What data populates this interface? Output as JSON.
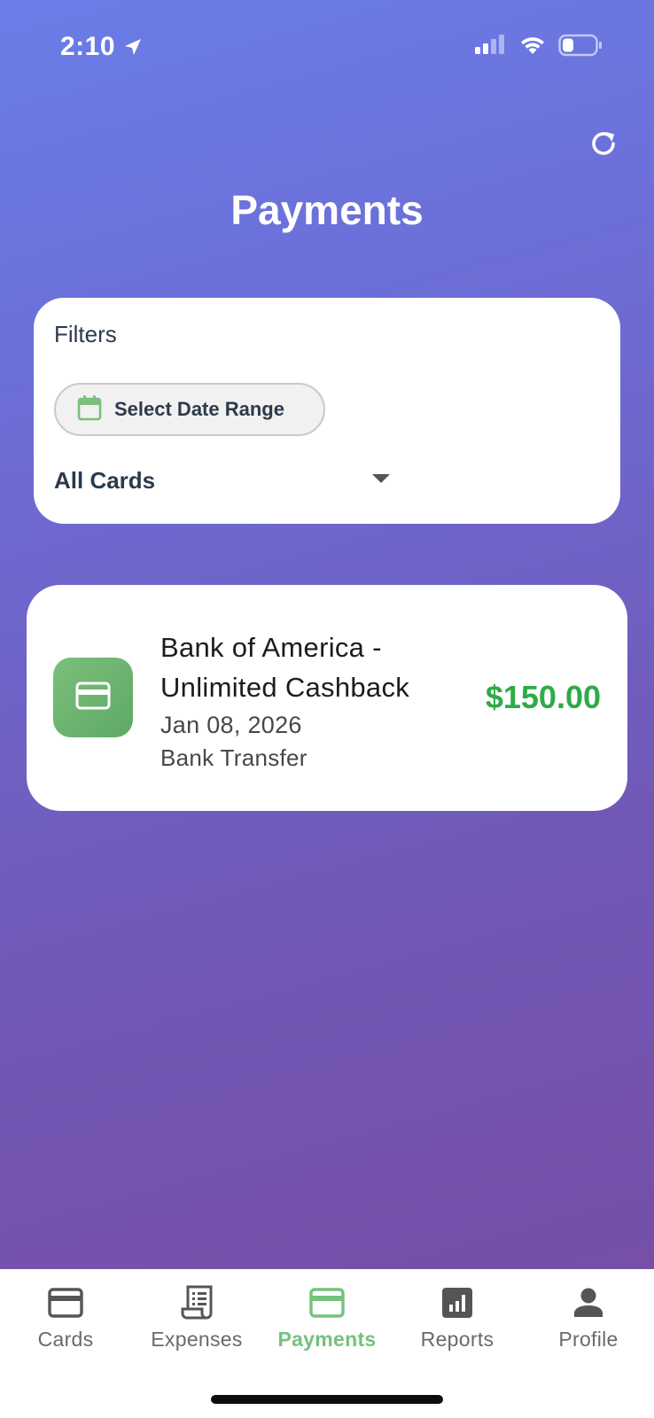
{
  "status_bar": {
    "time": "2:10",
    "icons": [
      "location-arrow-icon",
      "cellular-signal-icon",
      "wifi-icon",
      "battery-icon"
    ]
  },
  "header": {
    "title": "Payments",
    "refresh_icon": "refresh-icon"
  },
  "filters": {
    "title": "Filters",
    "date_range_label": "Select Date Range",
    "date_icon": "calendar-icon",
    "card_select_value": "All Cards",
    "card_select_icon": "caret-down-icon"
  },
  "payments": [
    {
      "name": "Bank of America - Unlimited Cashback",
      "date": "Jan 08, 2026",
      "method": "Bank Transfer",
      "amount": "$150.00",
      "icon": "credit-card-icon"
    }
  ],
  "tabs": [
    {
      "label": "Cards",
      "icon": "credit-card-icon",
      "active": false
    },
    {
      "label": "Expenses",
      "icon": "receipt-icon",
      "active": false
    },
    {
      "label": "Payments",
      "icon": "credit-card-icon",
      "active": true
    },
    {
      "label": "Reports",
      "icon": "bar-chart-icon",
      "active": false
    },
    {
      "label": "Profile",
      "icon": "person-icon",
      "active": false
    }
  ],
  "colors": {
    "gradient_top": "#6a7de8",
    "gradient_bottom": "#774ca4",
    "accent_green": "#2faa48",
    "active_tab": "#74c27c",
    "inactive_tab": "#6a6a6a",
    "text_dark": "#2c3a4b"
  }
}
